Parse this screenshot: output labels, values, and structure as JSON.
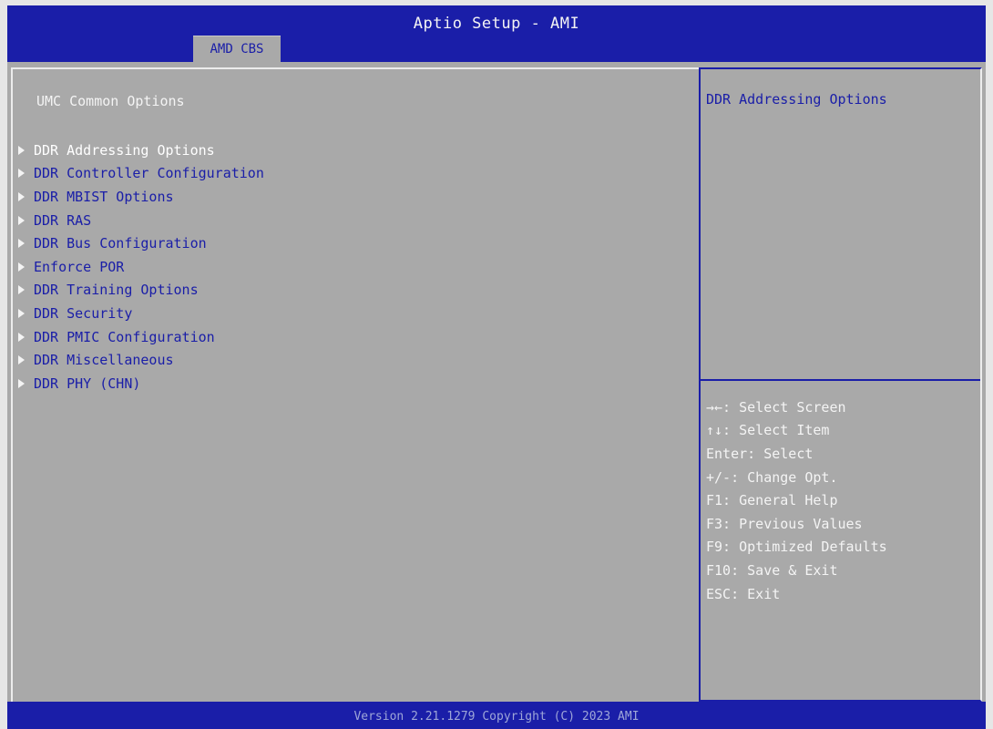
{
  "header": {
    "title": "Aptio Setup - AMI",
    "active_tab": "AMD CBS"
  },
  "main": {
    "section_title": "UMC Common Options",
    "menu_items": [
      "DDR Addressing Options",
      "DDR Controller Configuration",
      "DDR MBIST Options",
      "DDR RAS",
      "DDR Bus Configuration",
      "Enforce POR",
      "DDR Training Options",
      "DDR Security",
      "DDR PMIC Configuration",
      "DDR Miscellaneous",
      "DDR PHY (CHN)"
    ],
    "selected_index": 0
  },
  "help": {
    "description": "DDR Addressing Options",
    "keys": [
      "→←: Select Screen",
      "↑↓: Select Item",
      "Enter: Select",
      "+/-: Change Opt.",
      "F1: General Help",
      "F3: Previous Values",
      "F9: Optimized Defaults",
      "F10: Save & Exit",
      "ESC: Exit"
    ]
  },
  "footer": {
    "version": "Version 2.21.1279 Copyright (C) 2023 AMI"
  },
  "colors": {
    "header_bg": "#1a1ea8",
    "panel_bg": "#a9a9a9",
    "text_white": "#f4f4f4",
    "text_blue": "#1a1ea8"
  }
}
